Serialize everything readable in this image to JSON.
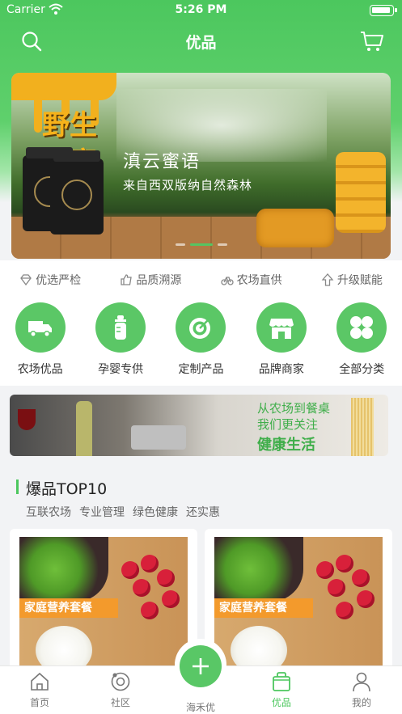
{
  "status_bar": {
    "carrier": "Carrier",
    "time": "5:26 PM"
  },
  "navbar": {
    "title": "优品",
    "left_icon": "search-icon",
    "right_icon": "cart-icon"
  },
  "banner": {
    "headline": "野生蜂蜜",
    "brand": "滇云蜜语",
    "subtitle": "来自西双版纳自然森林",
    "page_indicator": {
      "count": 3,
      "active": 2
    }
  },
  "features": [
    {
      "label": "优选严检",
      "icon": "diamond-icon"
    },
    {
      "label": "品质溯源",
      "icon": "thumbs-up-icon"
    },
    {
      "label": "农场直供",
      "icon": "bicycle-icon"
    },
    {
      "label": "升级赋能",
      "icon": "arrow-up-icon"
    }
  ],
  "categories": [
    {
      "label": "农场优品",
      "icon": "truck-icon"
    },
    {
      "label": "孕婴专供",
      "icon": "baby-bottle-icon"
    },
    {
      "label": "定制产品",
      "icon": "target-icon"
    },
    {
      "label": "品牌商家",
      "icon": "storefront-icon"
    },
    {
      "label": "全部分类",
      "icon": "grid-icon"
    }
  ],
  "promo": {
    "line1": "从农场到餐桌",
    "line2": "我们更关注",
    "line3": "健康生活"
  },
  "top10": {
    "title": "爆品TOP10",
    "tags": [
      "互联农场",
      "专业管理",
      "绿色健康",
      "还实惠"
    ],
    "cards": [
      {
        "tag": "家庭营养套餐"
      },
      {
        "tag": "家庭营养套餐"
      }
    ]
  },
  "tabbar": {
    "items": [
      {
        "label": "首页",
        "icon": "home-icon",
        "active": false
      },
      {
        "label": "社区",
        "icon": "community-icon",
        "active": false
      },
      {
        "label": "海禾优",
        "icon": "plus-icon",
        "active": false
      },
      {
        "label": "优品",
        "icon": "shopping-bag-icon",
        "active": true
      },
      {
        "label": "我的",
        "icon": "user-icon",
        "active": false
      }
    ]
  },
  "colors": {
    "brand_green": "#4cc75e",
    "accent_orange": "#f39a2c"
  }
}
